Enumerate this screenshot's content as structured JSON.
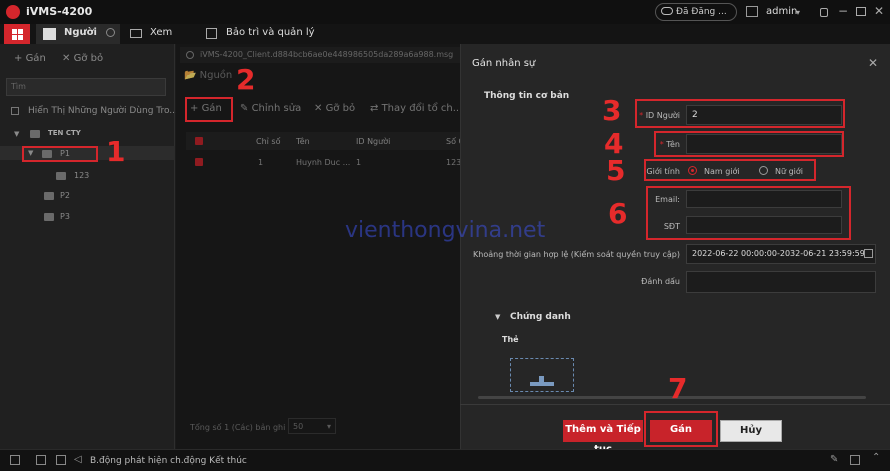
{
  "app": {
    "title": "iVMS-4200"
  },
  "titlebar": {
    "cloud_label": "Đã Đăng ...",
    "user": "admin"
  },
  "modules": {
    "people": "Người",
    "view": "Xem",
    "maintenance": "Bảo trì và quản lý"
  },
  "left": {
    "add": "Gán",
    "remove": "Gỡ bỏ",
    "search_placeholder": "Tìm",
    "show_sub": "Hiển Thị Những Người Dùng Tro...",
    "tree": {
      "root": "TEN CTY",
      "p1": "P1",
      "sub": "123",
      "p2": "P2",
      "p3": "P3"
    }
  },
  "mid": {
    "path": "iVMS-4200_Client.d884bcb6ae0e448986505da289a6a988.msg",
    "source": "Nguồn",
    "toolbar": {
      "add": "Gán",
      "edit": "Chỉnh sửa",
      "remove": "Gỡ bỏ",
      "change": "Thay đổi tổ ch..."
    },
    "columns": {
      "index": "Chỉ số",
      "name": "Tên",
      "id": "ID Người",
      "num": "Số C"
    },
    "row": {
      "index": "1",
      "name": "Huynh Duc ...",
      "id": "1",
      "num": "123"
    },
    "footer": "Tổng số 1 (Các) bản ghi",
    "page_size": "50"
  },
  "dialog": {
    "title": "Gán nhân sự",
    "basic_info": "Thông tin cơ bản",
    "id_label": "ID Người",
    "id_value": "2",
    "name_label": "Tên",
    "gender_label": "Giới tính",
    "male": "Nam giới",
    "female": "Nữ giới",
    "email_label": "Email:",
    "phone_label": "SĐT",
    "validity_label": "Khoảng thời gian hợp lệ (Kiểm soát quyền truy cập)",
    "validity_value": "2022-06-22 00:00:00-2032-06-21 23:59:59",
    "remark_label": "Đánh dấu",
    "credential": "Chứng danh",
    "card": "Thẻ",
    "btn_add_continue": "Thêm và Tiếp tục",
    "btn_add": "Gán",
    "btn_cancel": "Hủy"
  },
  "annotations": [
    "1",
    "2",
    "3",
    "4",
    "5",
    "6",
    "7"
  ],
  "status": {
    "text": "B.động phát hiện ch.động Kết thúc"
  },
  "watermark": "vienthongvina.net",
  "colors": {
    "accent": "#d4262c",
    "annotation": "#e62b2b"
  }
}
